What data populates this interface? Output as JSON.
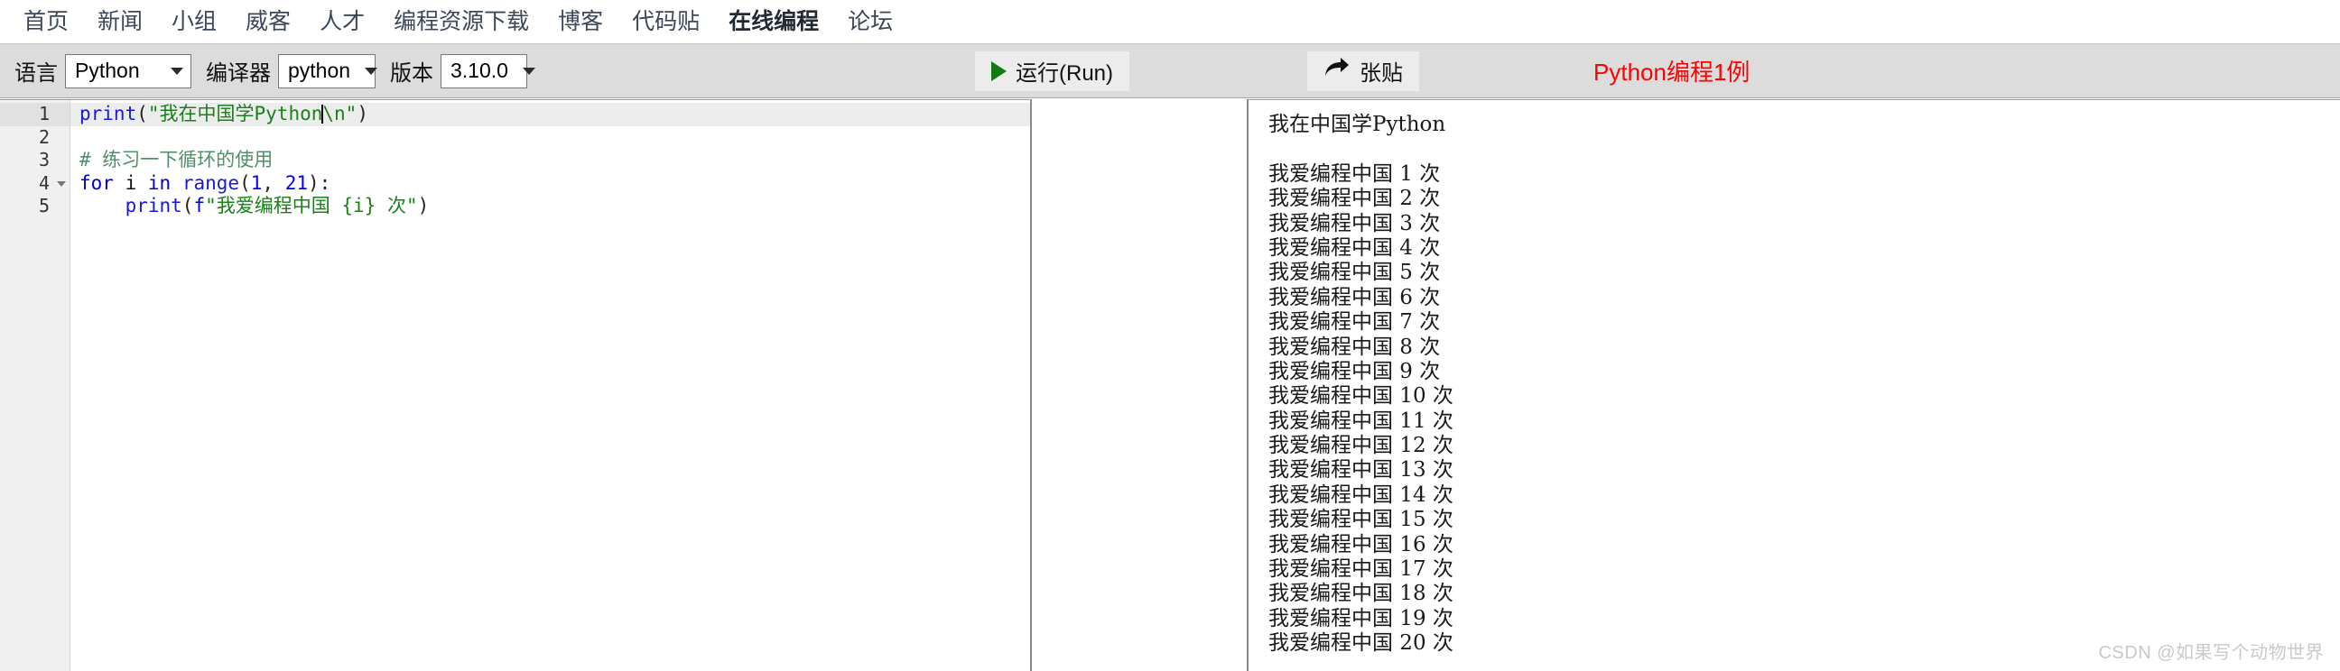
{
  "nav": {
    "items": [
      {
        "label": "首页",
        "active": false
      },
      {
        "label": "新闻",
        "active": false
      },
      {
        "label": "小组",
        "active": false
      },
      {
        "label": "威客",
        "active": false
      },
      {
        "label": "人才",
        "active": false
      },
      {
        "label": "编程资源下载",
        "active": false
      },
      {
        "label": "博客",
        "active": false
      },
      {
        "label": "代码贴",
        "active": false
      },
      {
        "label": "在线编程",
        "active": true
      },
      {
        "label": "论坛",
        "active": false
      }
    ]
  },
  "toolbar": {
    "language_label": "语言",
    "language_value": "Python",
    "compiler_label": "编译器",
    "compiler_value": "python",
    "version_label": "版本",
    "version_value": "3.10.0",
    "run_label": "运行(Run)",
    "run_icon": "play-triangle-icon",
    "post_label": "张贴",
    "post_icon": "share-arrow-icon",
    "title": "Python编程1例",
    "title_color": "#ff0000"
  },
  "editor": {
    "line_numbers": [
      "1",
      "2",
      "3",
      "4",
      "5"
    ],
    "fold_line": 4,
    "current_line": 1,
    "lines": [
      {
        "n": 1,
        "tokens": [
          {
            "t": "print",
            "c": "fn"
          },
          {
            "t": "(",
            "c": "pn"
          },
          {
            "t": "\"我在中国学Python",
            "c": "str"
          },
          {
            "t": "CARET",
            "c": "caret"
          },
          {
            "t": "\\n\"",
            "c": "str"
          },
          {
            "t": ")",
            "c": "pn"
          }
        ]
      },
      {
        "n": 2,
        "tokens": []
      },
      {
        "n": 3,
        "tokens": [
          {
            "t": "# 练习一下循环的使用",
            "c": "cmt"
          }
        ]
      },
      {
        "n": 4,
        "tokens": [
          {
            "t": "for",
            "c": "kw"
          },
          {
            "t": " ",
            "c": "pn"
          },
          {
            "t": "i",
            "c": "var"
          },
          {
            "t": " ",
            "c": "pn"
          },
          {
            "t": "in",
            "c": "kw"
          },
          {
            "t": " ",
            "c": "pn"
          },
          {
            "t": "range",
            "c": "fn"
          },
          {
            "t": "(",
            "c": "pn"
          },
          {
            "t": "1",
            "c": "num"
          },
          {
            "t": ", ",
            "c": "pn"
          },
          {
            "t": "21",
            "c": "num"
          },
          {
            "t": "):",
            "c": "pn"
          }
        ]
      },
      {
        "n": 5,
        "tokens": [
          {
            "t": "    ",
            "c": "pn"
          },
          {
            "t": "print",
            "c": "fn"
          },
          {
            "t": "(",
            "c": "pn"
          },
          {
            "t": "f",
            "c": "kw"
          },
          {
            "t": "\"我爱编程中国 {i} 次\"",
            "c": "str"
          },
          {
            "t": ")",
            "c": "pn"
          }
        ]
      }
    ]
  },
  "output": {
    "lines": [
      "我在中国学Python",
      "",
      "我爱编程中国 1 次",
      "我爱编程中国 2 次",
      "我爱编程中国 3 次",
      "我爱编程中国 4 次",
      "我爱编程中国 5 次",
      "我爱编程中国 6 次",
      "我爱编程中国 7 次",
      "我爱编程中国 8 次",
      "我爱编程中国 9 次",
      "我爱编程中国 10 次",
      "我爱编程中国 11 次",
      "我爱编程中国 12 次",
      "我爱编程中国 13 次",
      "我爱编程中国 14 次",
      "我爱编程中国 15 次",
      "我爱编程中国 16 次",
      "我爱编程中国 17 次",
      "我爱编程中国 18 次",
      "我爱编程中国 19 次",
      "我爱编程中国 20 次"
    ]
  },
  "watermark": {
    "text": "CSDN @如果写个动物世界"
  }
}
